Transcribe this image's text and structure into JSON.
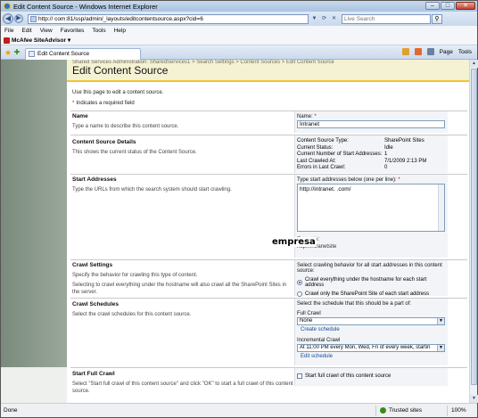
{
  "window": {
    "title": "Edit Content Source - Windows Internet Explorer"
  },
  "address": {
    "url": "http://          com:81/ssp/admin/_layouts/editcontentsource.aspx?cid=6",
    "search_placeholder": "Live Search"
  },
  "menu": [
    "File",
    "Edit",
    "View",
    "Favorites",
    "Tools",
    "Help"
  ],
  "links": {
    "mcafee": "McAfee SiteAdvisor"
  },
  "tab": {
    "label": "Edit Content Source"
  },
  "commands": {
    "page": "Page",
    "tools": "Tools"
  },
  "page": {
    "breadcrumb": "Shared Services Administration: SharedServices1  >  Search Settings  >  Content Sources  >  Edit Content Source",
    "title": "Edit Content Source",
    "intro": "Use this page to edit a content source.",
    "required_note": "Indicates a required field"
  },
  "sections": {
    "name": {
      "heading": "Name",
      "desc": "Type a name to describe this content source.",
      "field_label": "Name:",
      "value": "Intranet"
    },
    "details": {
      "heading": "Content Source Details",
      "desc": "This shows the current status of the Content Source.",
      "rows": [
        {
          "label": "Content Source Type:",
          "value": "SharePoint Sites"
        },
        {
          "label": "Current Status:",
          "value": "Idle"
        },
        {
          "label": "Current Number of Start Addresses:",
          "value": "1"
        },
        {
          "label": "Last Crawled At:",
          "value": "7/1/2009 2:13 PM"
        },
        {
          "label": "Errors in Last Crawl:",
          "value": "0"
        }
      ]
    },
    "start": {
      "heading": "Start Addresses",
      "desc": "Type the URLs from which the search system should start crawling.",
      "field_label": "Type start addresses below (one per line):",
      "value": "http://intranet.              .com/",
      "watermark": "empresa",
      "example_label": "Example:",
      "example_value": "http://intranetsite"
    },
    "crawl_settings": {
      "heading": "Crawl Settings",
      "desc1": "Specify the behavior for crawling this type of content.",
      "desc2": "Selecting to crawl everything under the hostname will also crawl all the SharePoint Sites in the server.",
      "field_label": "Select crawling behavior for all start addresses in this content source:",
      "option1": "Crawl everything under the hostname for each start address",
      "option2": "Crawl only the SharePoint Site of each start address"
    },
    "schedules": {
      "heading": "Crawl Schedules",
      "desc": "Select the crawl schedules for this content source.",
      "field_label": "Select the schedule that this should be a part of:",
      "full_label": "Full Crawl",
      "full_value": "None",
      "full_link": "Create schedule",
      "inc_label": "Incremental Crawl",
      "inc_value": "At 11:00 PM every Mon, Wed, Fri of every week, startin",
      "inc_link": "Edit schedule"
    },
    "full_crawl": {
      "heading": "Start Full Crawl",
      "desc": "Select \"Start full crawl of this content source\" and click \"OK\" to start a full crawl of this content source.",
      "checkbox": "Start full crawl of this content source"
    }
  },
  "status": {
    "left": "Done",
    "zone": "Trusted sites",
    "zoom": "100%"
  }
}
